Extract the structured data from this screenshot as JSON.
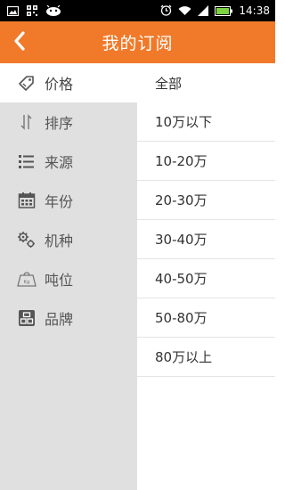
{
  "status_bar": {
    "time": "14:38",
    "left_icons": [
      "image-icon",
      "qr-code-icon",
      "android-robot-icon"
    ],
    "right_icons": [
      "alarm-icon",
      "wifi-icon",
      "signal-icon",
      "battery-icon"
    ]
  },
  "header": {
    "title": "我的订阅",
    "background": "#f07a2a"
  },
  "sidebar": {
    "items": [
      {
        "label": "价格",
        "icon": "price-tag-icon",
        "active": true
      },
      {
        "label": "排序",
        "icon": "sort-icon",
        "active": false
      },
      {
        "label": "来源",
        "icon": "list-icon",
        "active": false
      },
      {
        "label": "年份",
        "icon": "calendar-icon",
        "active": false
      },
      {
        "label": "机种",
        "icon": "gears-icon",
        "active": false
      },
      {
        "label": "吨位",
        "icon": "weight-icon",
        "active": false
      },
      {
        "label": "品牌",
        "icon": "brand-icon",
        "active": false
      }
    ]
  },
  "options": {
    "items": [
      "全部",
      "10万以下",
      "10-20万",
      "20-30万",
      "30-40万",
      "40-50万",
      "50-80万",
      "80万以上"
    ]
  }
}
